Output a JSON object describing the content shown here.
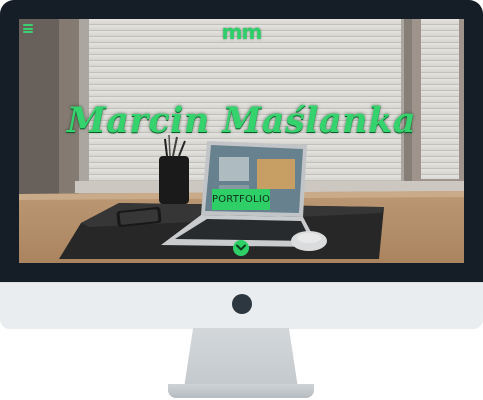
{
  "site": {
    "logo_text": "mm",
    "hero_title": "Marcin Maślanka",
    "cta_label": "PORTFOLIO"
  },
  "icons": {
    "menu": "hamburger-menu-icon",
    "scroll": "chevron-down-icon"
  },
  "colors": {
    "accent": "#2fcf67",
    "bezel": "#151d26",
    "chin": "#eaedef"
  }
}
